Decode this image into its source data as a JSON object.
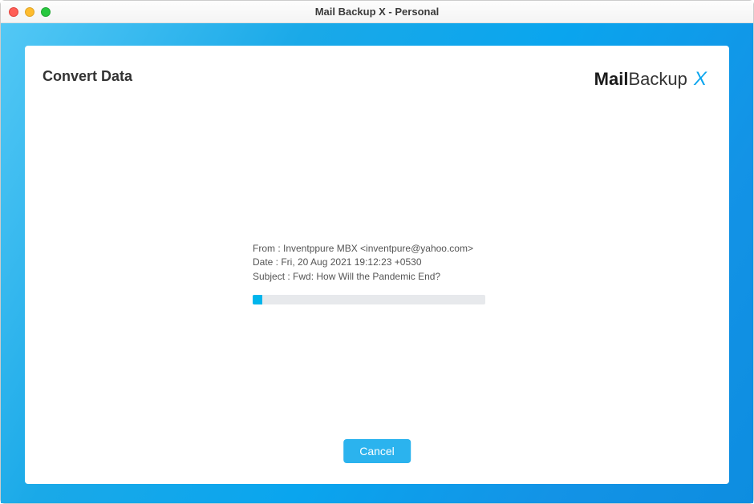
{
  "window": {
    "title": "Mail Backup X - Personal"
  },
  "header": {
    "page_title": "Convert Data",
    "logo_mail": "Mail",
    "logo_backup": "Backup",
    "logo_x": "X"
  },
  "progress": {
    "from_line": "From : Inventppure MBX <inventpure@yahoo.com>",
    "date_line": "Date : Fri, 20 Aug 2021 19:12:23 +0530",
    "subject_line": "Subject : Fwd: How Will the Pandemic End?",
    "percent": 4
  },
  "buttons": {
    "cancel": "Cancel"
  }
}
